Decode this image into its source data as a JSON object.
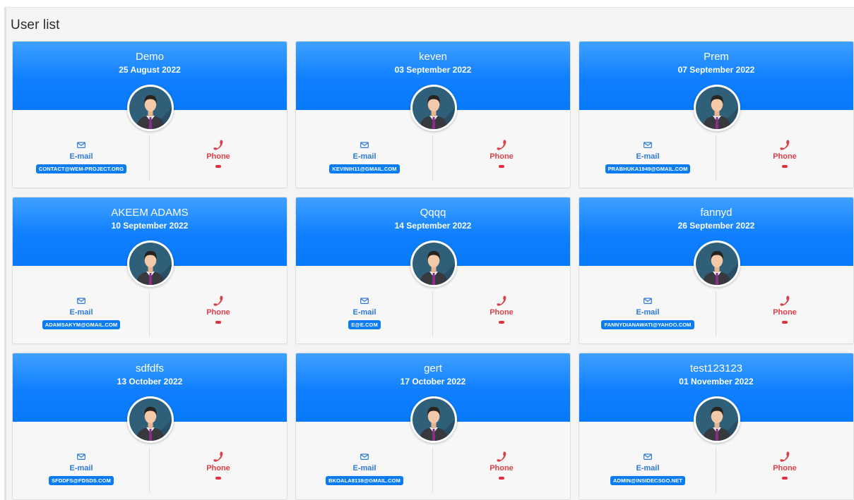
{
  "page": {
    "title": "User list"
  },
  "labels": {
    "email": "E-mail",
    "phone": "Phone"
  },
  "colors": {
    "header_blue": "#0f7fff",
    "email_blue": "#2e7ad8",
    "phone_red": "#d9404a"
  },
  "icons": {
    "email": "envelope-icon",
    "phone": "phone-icon",
    "avatar": "user-avatar-icon"
  },
  "users": [
    {
      "name": "Demo",
      "date": "25 August 2022",
      "email": "CONTACT@WEM-PROJECT.ORG"
    },
    {
      "name": "keven",
      "date": "03 September 2022",
      "email": "KEVINIH11@GMAIL.COM"
    },
    {
      "name": "Prem",
      "date": "07 September 2022",
      "email": "PRABHUKA1949@GMAIL.COM"
    },
    {
      "name": "AKEEM ADAMS",
      "date": "10 September 2022",
      "email": "ADAMSAKYM@GMAIL.COM"
    },
    {
      "name": "Qqqq",
      "date": "14 September 2022",
      "email": "E@E.COM"
    },
    {
      "name": "fannyd",
      "date": "26 September 2022",
      "email": "FANNYDIANAWATI@YAHOO.COM"
    },
    {
      "name": "sdfdfs",
      "date": "13 October 2022",
      "email": "SFDDFS@FDSDS.COM"
    },
    {
      "name": "gert",
      "date": "17 October 2022",
      "email": "BKOALA8138@GMAIL.COM"
    },
    {
      "name": "test123123",
      "date": "01 November 2022",
      "email": "ADMIN@INSIDECSGO.NET"
    }
  ]
}
